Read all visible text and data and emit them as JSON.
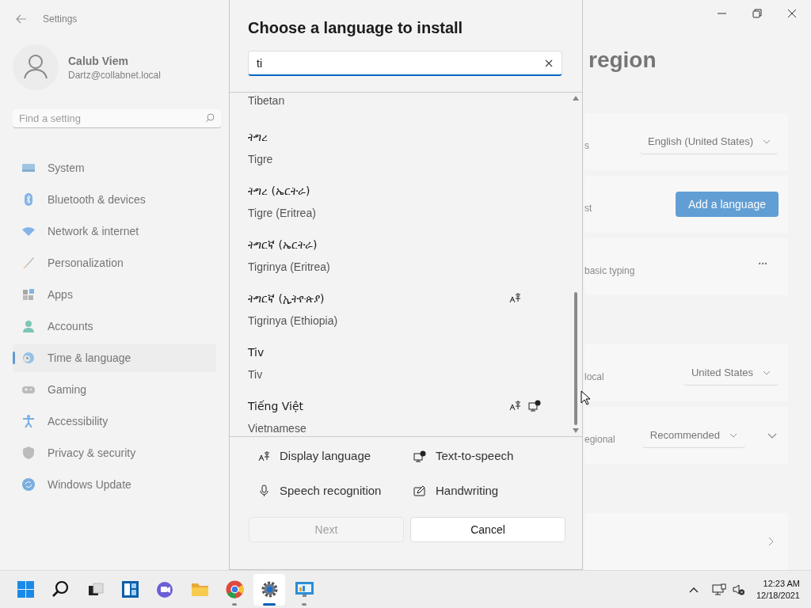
{
  "settings": {
    "app_title": "Settings",
    "user": {
      "name": "Calub Viem",
      "email": "Dartz@collabnet.local"
    },
    "search": {
      "placeholder": "Find a setting"
    },
    "nav": [
      {
        "label": "System",
        "kind": "system",
        "selected": false
      },
      {
        "label": "Bluetooth & devices",
        "kind": "bluetooth",
        "selected": false
      },
      {
        "label": "Network & internet",
        "kind": "network",
        "selected": false
      },
      {
        "label": "Personalization",
        "kind": "brush",
        "selected": false
      },
      {
        "label": "Apps",
        "kind": "apps",
        "selected": false
      },
      {
        "label": "Accounts",
        "kind": "accounts",
        "selected": false
      },
      {
        "label": "Time & language",
        "kind": "time",
        "selected": true
      },
      {
        "label": "Gaming",
        "kind": "gaming",
        "selected": false
      },
      {
        "label": "Accessibility",
        "kind": "accessibility",
        "selected": false
      },
      {
        "label": "Privacy & security",
        "kind": "shield",
        "selected": false
      },
      {
        "label": "Windows Update",
        "kind": "update",
        "selected": false
      }
    ],
    "page_title": "region",
    "groups": [
      {
        "cards": [
          {
            "label": "s",
            "control": {
              "kind": "dropdown",
              "value": "English (United States)"
            }
          },
          {
            "label": "st",
            "control": {
              "kind": "button",
              "text": "Add a language"
            }
          },
          {
            "label": "basic typing",
            "control": {
              "kind": "more",
              "text": "..."
            }
          }
        ]
      },
      {
        "cards": [
          {
            "label": "local",
            "control": {
              "kind": "dropdown",
              "value": "United States"
            }
          },
          {
            "label": "egional",
            "control": {
              "kind": "dropdown",
              "value": "Recommended"
            },
            "expandable": true
          }
        ]
      },
      {
        "cards": [
          {
            "control": {
              "kind": "chevron"
            }
          }
        ]
      }
    ]
  },
  "dialog": {
    "title": "Choose a language to install",
    "search": {
      "value": "ti"
    },
    "languages": [
      {
        "english": "Tibetan"
      },
      {
        "native": "ትግረ",
        "english": "Tigre",
        "display_language": false,
        "text_to_speech": false
      },
      {
        "native": "ትግረ (ኤርትራ)",
        "english": "Tigre (Eritrea)",
        "display_language": false,
        "text_to_speech": false
      },
      {
        "native": "ትግርኛ (ኤርትራ)",
        "english": "Tigrinya (Eritrea)",
        "display_language": false,
        "text_to_speech": false
      },
      {
        "native": "ትግርኛ (ኢትዮጵያ)",
        "english": "Tigrinya (Ethiopia)",
        "display_language": true,
        "text_to_speech": false
      },
      {
        "native": "Tiv",
        "english": "Tiv",
        "display_language": false,
        "text_to_speech": false
      },
      {
        "native": "Tiếng Việt",
        "english": "Vietnamese",
        "display_language": true,
        "text_to_speech": true
      }
    ],
    "legend": [
      {
        "kind": "display",
        "label": "Display language"
      },
      {
        "kind": "tts",
        "label": "Text-to-speech"
      },
      {
        "kind": "speech",
        "label": "Speech recognition"
      },
      {
        "kind": "handwriting",
        "label": "Handwriting"
      }
    ],
    "buttons": [
      {
        "label": "Next",
        "disabled": true
      },
      {
        "label": "Cancel",
        "disabled": false
      }
    ]
  },
  "taskbar": {
    "apps": [
      {
        "kind": "start",
        "running": false,
        "selected": false
      },
      {
        "kind": "search",
        "running": false,
        "selected": false
      },
      {
        "kind": "taskview",
        "running": false,
        "selected": false
      },
      {
        "kind": "widgets",
        "running": false,
        "selected": false
      },
      {
        "kind": "chat",
        "running": false,
        "selected": false
      },
      {
        "kind": "folder",
        "running": false,
        "selected": false
      },
      {
        "kind": "browser",
        "running": true,
        "selected": false
      },
      {
        "kind": "gear",
        "running": true,
        "selected": true
      },
      {
        "kind": "monitor",
        "running": true,
        "selected": false
      }
    ],
    "time": "12:23 AM",
    "date": "12/18/2021"
  }
}
